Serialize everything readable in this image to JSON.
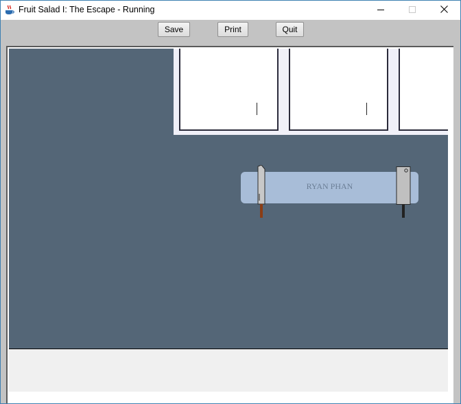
{
  "window": {
    "title": "Fruit Salad I: The Escape - Running",
    "icon": "java-coffee-cup-icon",
    "controls": [
      "minimize-icon",
      "maximize-icon",
      "close-icon"
    ]
  },
  "toolbar": {
    "save_label": "Save",
    "print_label": "Print",
    "quit_label": "Quit"
  },
  "scene": {
    "background_color": "#546677",
    "knife_rack": {
      "label": "RYAN PHAN",
      "color": "#a8bdd8",
      "items": [
        "kitchen-knife-icon",
        "meat-cleaver-icon"
      ]
    },
    "cabinets": [
      "cabinet-door",
      "cabinet-door",
      "cabinet-door"
    ]
  }
}
